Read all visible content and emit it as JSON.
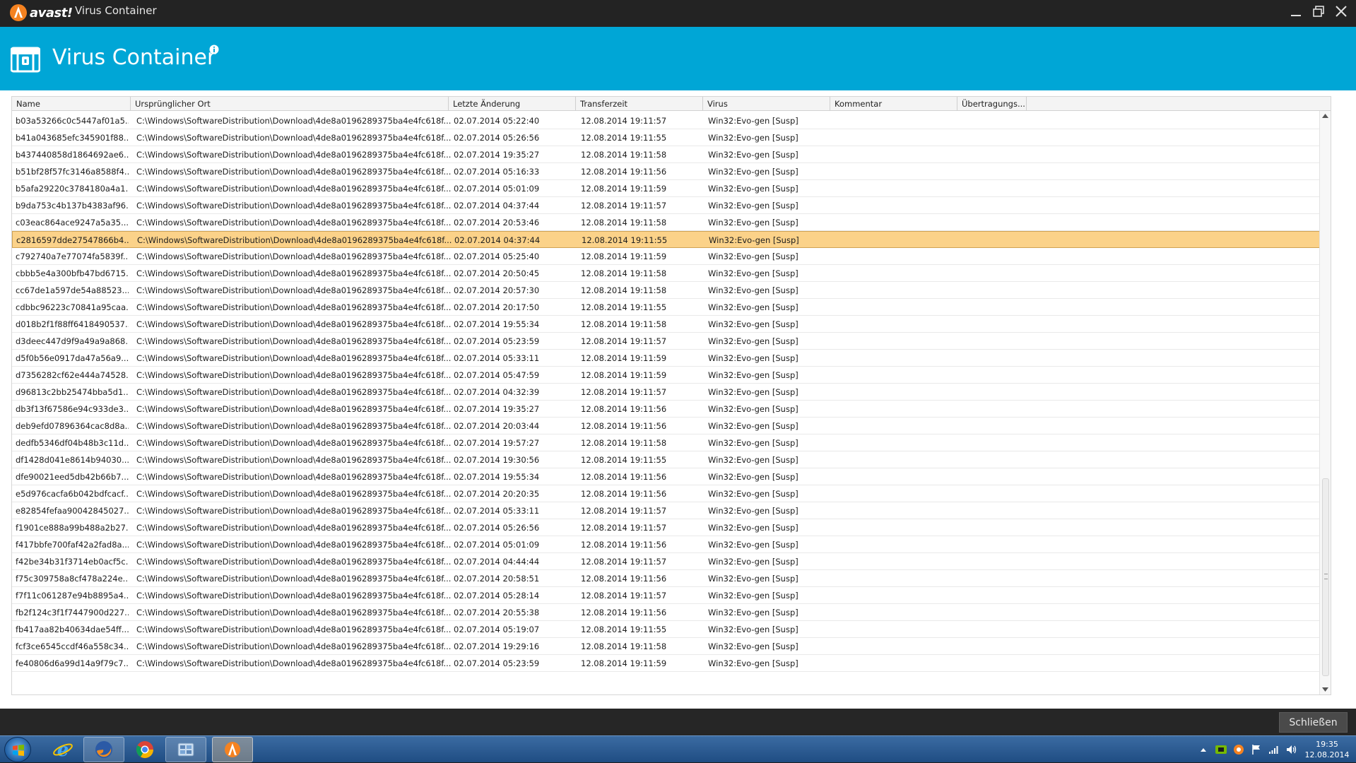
{
  "window": {
    "app_name": "avast!",
    "title": "Virus Container"
  },
  "header": {
    "title": "Virus Container"
  },
  "table": {
    "columns": [
      {
        "label": "Name"
      },
      {
        "label": "Ursprünglicher Ort"
      },
      {
        "label": "Letzte Änderung"
      },
      {
        "label": "Transferzeit"
      },
      {
        "label": "Virus"
      },
      {
        "label": "Kommentar"
      },
      {
        "label": "Übertragungs..."
      }
    ],
    "selected_index": 7,
    "rows": [
      [
        "b03a53266c0c5447af01a5...",
        "C:\\Windows\\SoftwareDistribution\\Download\\4de8a0196289375ba4e4fc618f...",
        "02.07.2014 05:22:40",
        "12.08.2014 19:11:57",
        "Win32:Evo-gen [Susp]"
      ],
      [
        "b41a043685efc345901f88...",
        "C:\\Windows\\SoftwareDistribution\\Download\\4de8a0196289375ba4e4fc618f...",
        "02.07.2014 05:26:56",
        "12.08.2014 19:11:55",
        "Win32:Evo-gen [Susp]"
      ],
      [
        "b437440858d1864692ae6...",
        "C:\\Windows\\SoftwareDistribution\\Download\\4de8a0196289375ba4e4fc618f...",
        "02.07.2014 19:35:27",
        "12.08.2014 19:11:58",
        "Win32:Evo-gen [Susp]"
      ],
      [
        "b51bf28f57fc3146a8588f4...",
        "C:\\Windows\\SoftwareDistribution\\Download\\4de8a0196289375ba4e4fc618f...",
        "02.07.2014 05:16:33",
        "12.08.2014 19:11:56",
        "Win32:Evo-gen [Susp]"
      ],
      [
        "b5afa29220c3784180a4a1...",
        "C:\\Windows\\SoftwareDistribution\\Download\\4de8a0196289375ba4e4fc618f...",
        "02.07.2014 05:01:09",
        "12.08.2014 19:11:59",
        "Win32:Evo-gen [Susp]"
      ],
      [
        "b9da753c4b137b4383af96...",
        "C:\\Windows\\SoftwareDistribution\\Download\\4de8a0196289375ba4e4fc618f...",
        "02.07.2014 04:37:44",
        "12.08.2014 19:11:57",
        "Win32:Evo-gen [Susp]"
      ],
      [
        "c03eac864ace9247a5a35...",
        "C:\\Windows\\SoftwareDistribution\\Download\\4de8a0196289375ba4e4fc618f...",
        "02.07.2014 20:53:46",
        "12.08.2014 19:11:58",
        "Win32:Evo-gen [Susp]"
      ],
      [
        "c2816597dde27547866b4...",
        "C:\\Windows\\SoftwareDistribution\\Download\\4de8a0196289375ba4e4fc618f...",
        "02.07.2014 04:37:44",
        "12.08.2014 19:11:55",
        "Win32:Evo-gen [Susp]"
      ],
      [
        "c792740a7e77074fa5839f...",
        "C:\\Windows\\SoftwareDistribution\\Download\\4de8a0196289375ba4e4fc618f...",
        "02.07.2014 05:25:40",
        "12.08.2014 19:11:59",
        "Win32:Evo-gen [Susp]"
      ],
      [
        "cbbb5e4a300bfb47bd6715...",
        "C:\\Windows\\SoftwareDistribution\\Download\\4de8a0196289375ba4e4fc618f...",
        "02.07.2014 20:50:45",
        "12.08.2014 19:11:58",
        "Win32:Evo-gen [Susp]"
      ],
      [
        "cc67de1a597de54a88523...",
        "C:\\Windows\\SoftwareDistribution\\Download\\4de8a0196289375ba4e4fc618f...",
        "02.07.2014 20:57:30",
        "12.08.2014 19:11:58",
        "Win32:Evo-gen [Susp]"
      ],
      [
        "cdbbc96223c70841a95caa...",
        "C:\\Windows\\SoftwareDistribution\\Download\\4de8a0196289375ba4e4fc618f...",
        "02.07.2014 20:17:50",
        "12.08.2014 19:11:55",
        "Win32:Evo-gen [Susp]"
      ],
      [
        "d018b2f1f88ff6418490537...",
        "C:\\Windows\\SoftwareDistribution\\Download\\4de8a0196289375ba4e4fc618f...",
        "02.07.2014 19:55:34",
        "12.08.2014 19:11:58",
        "Win32:Evo-gen [Susp]"
      ],
      [
        "d3deec447d9f9a49a9a868...",
        "C:\\Windows\\SoftwareDistribution\\Download\\4de8a0196289375ba4e4fc618f...",
        "02.07.2014 05:23:59",
        "12.08.2014 19:11:57",
        "Win32:Evo-gen [Susp]"
      ],
      [
        "d5f0b56e0917da47a56a9...",
        "C:\\Windows\\SoftwareDistribution\\Download\\4de8a0196289375ba4e4fc618f...",
        "02.07.2014 05:33:11",
        "12.08.2014 19:11:59",
        "Win32:Evo-gen [Susp]"
      ],
      [
        "d7356282cf62e444a74528...",
        "C:\\Windows\\SoftwareDistribution\\Download\\4de8a0196289375ba4e4fc618f...",
        "02.07.2014 05:47:59",
        "12.08.2014 19:11:59",
        "Win32:Evo-gen [Susp]"
      ],
      [
        "d96813c2bb25474bba5d1...",
        "C:\\Windows\\SoftwareDistribution\\Download\\4de8a0196289375ba4e4fc618f...",
        "02.07.2014 04:32:39",
        "12.08.2014 19:11:57",
        "Win32:Evo-gen [Susp]"
      ],
      [
        "db3f13f67586e94c933de3...",
        "C:\\Windows\\SoftwareDistribution\\Download\\4de8a0196289375ba4e4fc618f...",
        "02.07.2014 19:35:27",
        "12.08.2014 19:11:56",
        "Win32:Evo-gen [Susp]"
      ],
      [
        "deb9efd07896364cac8d8a...",
        "C:\\Windows\\SoftwareDistribution\\Download\\4de8a0196289375ba4e4fc618f...",
        "02.07.2014 20:03:44",
        "12.08.2014 19:11:56",
        "Win32:Evo-gen [Susp]"
      ],
      [
        "dedfb5346df04b48b3c11d...",
        "C:\\Windows\\SoftwareDistribution\\Download\\4de8a0196289375ba4e4fc618f...",
        "02.07.2014 19:57:27",
        "12.08.2014 19:11:58",
        "Win32:Evo-gen [Susp]"
      ],
      [
        "df1428d041e8614b94030...",
        "C:\\Windows\\SoftwareDistribution\\Download\\4de8a0196289375ba4e4fc618f...",
        "02.07.2014 19:30:56",
        "12.08.2014 19:11:55",
        "Win32:Evo-gen [Susp]"
      ],
      [
        "dfe90021eed5db42b66b7...",
        "C:\\Windows\\SoftwareDistribution\\Download\\4de8a0196289375ba4e4fc618f...",
        "02.07.2014 19:55:34",
        "12.08.2014 19:11:56",
        "Win32:Evo-gen [Susp]"
      ],
      [
        "e5d976cacfa6b042bdfcacf...",
        "C:\\Windows\\SoftwareDistribution\\Download\\4de8a0196289375ba4e4fc618f...",
        "02.07.2014 20:20:35",
        "12.08.2014 19:11:56",
        "Win32:Evo-gen [Susp]"
      ],
      [
        "e82854fefaa90042845027...",
        "C:\\Windows\\SoftwareDistribution\\Download\\4de8a0196289375ba4e4fc618f...",
        "02.07.2014 05:33:11",
        "12.08.2014 19:11:57",
        "Win32:Evo-gen [Susp]"
      ],
      [
        "f1901ce888a99b488a2b27...",
        "C:\\Windows\\SoftwareDistribution\\Download\\4de8a0196289375ba4e4fc618f...",
        "02.07.2014 05:26:56",
        "12.08.2014 19:11:57",
        "Win32:Evo-gen [Susp]"
      ],
      [
        "f417bbfe700faf42a2fad8a...",
        "C:\\Windows\\SoftwareDistribution\\Download\\4de8a0196289375ba4e4fc618f...",
        "02.07.2014 05:01:09",
        "12.08.2014 19:11:56",
        "Win32:Evo-gen [Susp]"
      ],
      [
        "f42be34b31f3714eb0acf5c...",
        "C:\\Windows\\SoftwareDistribution\\Download\\4de8a0196289375ba4e4fc618f...",
        "02.07.2014 04:44:44",
        "12.08.2014 19:11:57",
        "Win32:Evo-gen [Susp]"
      ],
      [
        "f75c309758a8cf478a224e...",
        "C:\\Windows\\SoftwareDistribution\\Download\\4de8a0196289375ba4e4fc618f...",
        "02.07.2014 20:58:51",
        "12.08.2014 19:11:56",
        "Win32:Evo-gen [Susp]"
      ],
      [
        "f7f11c061287e94b8895a4...",
        "C:\\Windows\\SoftwareDistribution\\Download\\4de8a0196289375ba4e4fc618f...",
        "02.07.2014 05:28:14",
        "12.08.2014 19:11:57",
        "Win32:Evo-gen [Susp]"
      ],
      [
        "fb2f124c3f1f7447900d227...",
        "C:\\Windows\\SoftwareDistribution\\Download\\4de8a0196289375ba4e4fc618f...",
        "02.07.2014 20:55:38",
        "12.08.2014 19:11:56",
        "Win32:Evo-gen [Susp]"
      ],
      [
        "fb417aa82b40634dae54ff...",
        "C:\\Windows\\SoftwareDistribution\\Download\\4de8a0196289375ba4e4fc618f...",
        "02.07.2014 05:19:07",
        "12.08.2014 19:11:55",
        "Win32:Evo-gen [Susp]"
      ],
      [
        "fcf3ce6545ccdf46a558c34...",
        "C:\\Windows\\SoftwareDistribution\\Download\\4de8a0196289375ba4e4fc618f...",
        "02.07.2014 19:29:16",
        "12.08.2014 19:11:58",
        "Win32:Evo-gen [Susp]"
      ],
      [
        "fe40806d6a99d14a9f79c7...",
        "C:\\Windows\\SoftwareDistribution\\Download\\4de8a0196289375ba4e4fc618f...",
        "02.07.2014 05:23:59",
        "12.08.2014 19:11:59",
        "Win32:Evo-gen [Susp]"
      ]
    ]
  },
  "footer": {
    "close_label": "Schließen"
  },
  "taskbar": {
    "apps": [
      {
        "icon": "internet-explorer-icon"
      },
      {
        "icon": "firefox-icon"
      },
      {
        "icon": "chrome-icon"
      },
      {
        "icon": "control-panel-icon"
      },
      {
        "icon": "avast-icon"
      }
    ],
    "clock": {
      "time": "19:35",
      "date": "12.08.2014"
    }
  },
  "colors": {
    "header_bg": "#00a6d6",
    "selected_row_bg": "#fbd289",
    "avast_orange": "#f58220"
  }
}
